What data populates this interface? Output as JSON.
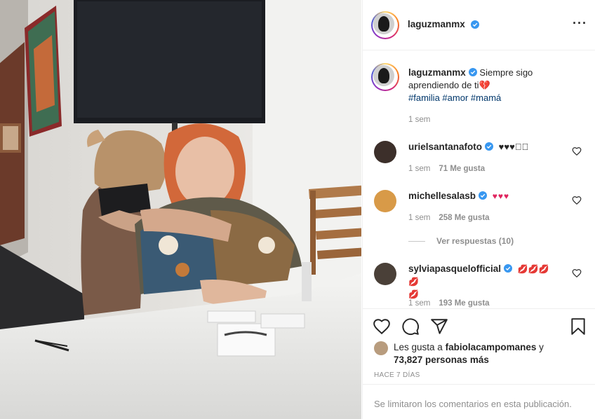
{
  "post": {
    "author": "laguzmanmx",
    "caption": {
      "text": "Siempre sigo aprendiendo de ti",
      "emoji": "💔",
      "hashtags": [
        "#familia",
        "#amor",
        "#mamá"
      ],
      "time": "1 sem"
    }
  },
  "header": {
    "username": "laguzmanmx",
    "more_icon": "more-horizontal-icon"
  },
  "comments": [
    {
      "username": "urielsantanafoto",
      "text": "♥♥♥",
      "extra": "🏼🏼",
      "time": "1 sem",
      "likes": "71 Me gusta"
    },
    {
      "username": "michellesalasb",
      "text": "♥♥♥",
      "time": "1 sem",
      "likes": "258 Me gusta",
      "replies": "Ver respuestas (10)"
    },
    {
      "username": "sylviapasquelofficial",
      "text": "💋💋💋💋",
      "text2": "💋",
      "time": "1 sem",
      "likes": "193 Me gusta"
    }
  ],
  "actions": {
    "likes_prefix": "Les gusta a",
    "likes_user": "fabiolacampomanes",
    "likes_conj": "y",
    "likes_count": "73,827 personas más",
    "timestamp": "HACE 7 DÍAS"
  },
  "footer": {
    "notice": "Se limitaron los comentarios en esta publicación."
  },
  "colors": {
    "verified": "#3897f0",
    "link": "#00376b",
    "muted": "#8e8e8e",
    "border": "#efefef"
  }
}
